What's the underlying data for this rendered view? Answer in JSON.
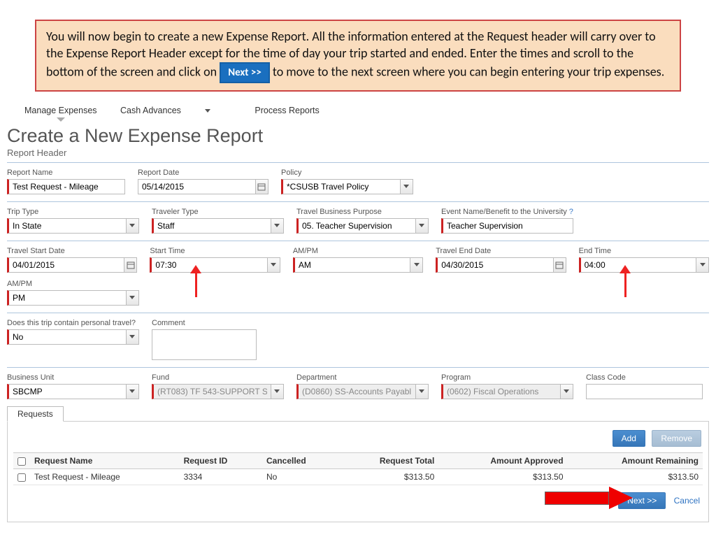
{
  "callout": {
    "text_before": "You will now begin to create a new Expense Report.  All the information entered at the Request header will carry over to the Expense Report Header except for the time of day your trip started and ended.  Enter the times and scroll to the bottom of the screen and click on ",
    "inline_button": "Next >>",
    "text_after": " to move to the next screen where you can begin entering your trip expenses."
  },
  "nav": {
    "manage_expenses": "Manage Expenses",
    "cash_advances": "Cash Advances",
    "process_reports": "Process Reports"
  },
  "page": {
    "title": "Create a New Expense Report",
    "subtitle": "Report Header"
  },
  "fields": {
    "report_name": {
      "label": "Report Name",
      "value": "Test Request - Mileage"
    },
    "report_date": {
      "label": "Report Date",
      "value": "05/14/2015"
    },
    "policy": {
      "label": "Policy",
      "value": "*CSUSB Travel Policy"
    },
    "trip_type": {
      "label": "Trip Type",
      "value": "In State"
    },
    "traveler_type": {
      "label": "Traveler Type",
      "value": "Staff"
    },
    "travel_purpose": {
      "label": "Travel Business Purpose",
      "value": "05. Teacher Supervision"
    },
    "event_name": {
      "label": "Event Name/Benefit to the University",
      "value": "Teacher Supervision"
    },
    "travel_start": {
      "label": "Travel Start Date",
      "value": "04/01/2015"
    },
    "start_time": {
      "label": "Start Time",
      "value": "07:30"
    },
    "start_ampm": {
      "label": "AM/PM",
      "value": "AM"
    },
    "travel_end": {
      "label": "Travel End Date",
      "value": "04/30/2015"
    },
    "end_time": {
      "label": "End Time",
      "value": "04:00"
    },
    "end_ampm": {
      "label": "AM/PM",
      "value": "PM"
    },
    "personal_travel": {
      "label": "Does this trip contain personal travel?",
      "value": "No"
    },
    "comment": {
      "label": "Comment",
      "value": ""
    },
    "business_unit": {
      "label": "Business Unit",
      "value": "SBCMP"
    },
    "fund": {
      "label": "Fund",
      "value": "(RT083) TF 543-SUPPORT S"
    },
    "department": {
      "label": "Department",
      "value": "(D0860) SS-Accounts Payabl"
    },
    "program": {
      "label": "Program",
      "value": "(0602) Fiscal Operations"
    },
    "class_code": {
      "label": "Class Code",
      "value": ""
    }
  },
  "requests": {
    "tab_label": "Requests",
    "add": "Add",
    "remove": "Remove",
    "columns": {
      "name": "Request Name",
      "id": "Request ID",
      "cancelled": "Cancelled",
      "total": "Request Total",
      "approved": "Amount Approved",
      "remaining": "Amount Remaining"
    },
    "rows": [
      {
        "name": "Test Request - Mileage",
        "id": "3334",
        "cancelled": "No",
        "total": "$313.50",
        "approved": "$313.50",
        "remaining": "$313.50"
      }
    ]
  },
  "footer": {
    "next": "Next >>",
    "cancel": "Cancel"
  }
}
